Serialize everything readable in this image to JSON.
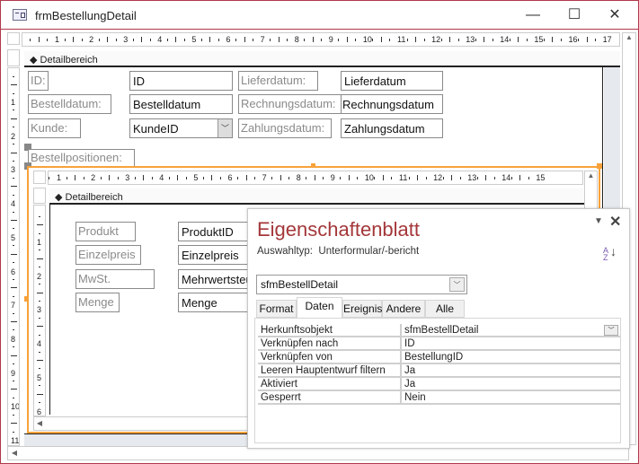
{
  "window": {
    "title": "frmBestellungDetail",
    "minimize": "—",
    "maximize": "☐",
    "close": "✕",
    "icon": "form-icon"
  },
  "ruler": {
    "main_top": [
      "1",
      "2",
      "3",
      "4",
      "5",
      "6",
      "7",
      "8",
      "9",
      "10",
      "11",
      "12",
      "13",
      "14",
      "15",
      "16",
      "17"
    ],
    "main_left": [
      "1",
      "2",
      "3",
      "4",
      "5",
      "6",
      "7",
      "8",
      "9",
      "10",
      "11"
    ],
    "sub_top": [
      "1",
      "2",
      "3",
      "4",
      "5",
      "6",
      "7",
      "8",
      "9",
      "10",
      "11",
      "12",
      "13",
      "14",
      "15"
    ],
    "sub_left": [
      "1",
      "2",
      "3",
      "4",
      "5",
      "6"
    ]
  },
  "form": {
    "section": "Detailbereich",
    "labels": {
      "id": "ID:",
      "bestelldatum": "Bestelldatum:",
      "kunde": "Kunde:",
      "lieferdatum": "Lieferdatum:",
      "rechnungsdatum": "Rechnungsdatum:",
      "zahlungsdatum": "Zahlungsdatum:",
      "bestellpositionen": "Bestellpositionen:"
    },
    "fields": {
      "id": "ID",
      "bestelldatum": "Bestelldatum",
      "kunde": "KundeID",
      "lieferdatum": "Lieferdatum",
      "rechnungsdatum": "Rechnungsdatum",
      "zahlungsdatum": "Zahlungsdatum"
    }
  },
  "subform": {
    "section": "Detailbereich",
    "labels": {
      "produkt": "Produkt",
      "einzelpreis": "Einzelpreis",
      "mwst": "MwSt.",
      "menge": "Menge"
    },
    "fields": {
      "produkt": "ProduktID",
      "einzelpreis": "Einzelpreis",
      "mwst": "Mehrwertsteuer",
      "menge": "Menge"
    }
  },
  "property_sheet": {
    "title": "Eigenschaftenblatt",
    "selection_type_label": "Auswahltyp:",
    "selection_type": "Unterformular/-bericht",
    "object": "sfmBestellDetail",
    "tabs": [
      "Format",
      "Daten",
      "Ereignis",
      "Andere",
      "Alle"
    ],
    "active_tab": "Daten",
    "properties": [
      {
        "name": "Herkunftsobjekt",
        "value": "sfmBestellDetail"
      },
      {
        "name": "Verknüpfen nach",
        "value": "ID"
      },
      {
        "name": "Verknüpfen von",
        "value": "BestellungID"
      },
      {
        "name": "Leeren Hauptentwurf filtern",
        "value": "Ja"
      },
      {
        "name": "Aktiviert",
        "value": "Ja"
      },
      {
        "name": "Gesperrt",
        "value": "Nein"
      }
    ]
  },
  "colors": {
    "accent": "#b0394a",
    "selection": "#f7a23a",
    "title": "#a4373a"
  }
}
